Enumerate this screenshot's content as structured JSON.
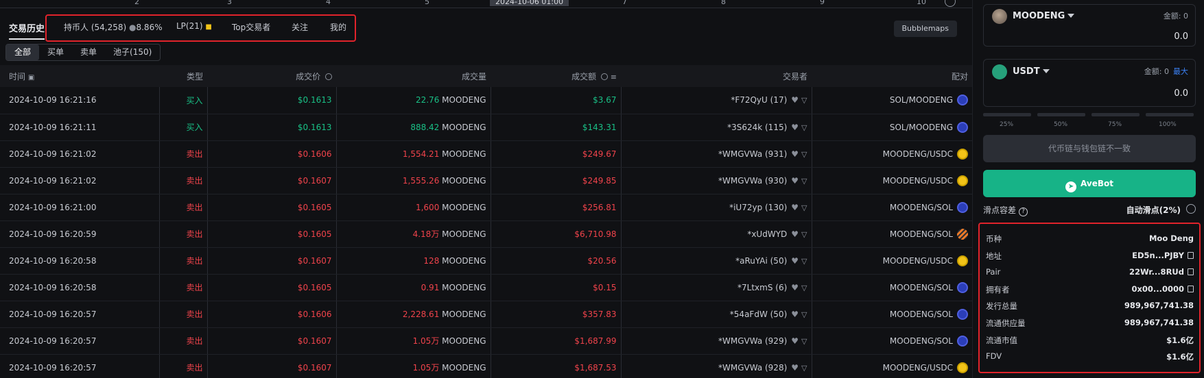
{
  "axis": {
    "ticks": [
      "2",
      "3",
      "4",
      "5",
      "7",
      "8",
      "9",
      "10"
    ],
    "crosshair_date": "2024-10-06   01:00"
  },
  "tabs": {
    "active": "交易历史",
    "holders_label": "持币人 (54,258)",
    "holders_pct": "8.86%",
    "lp": "LP(21)",
    "top_traders": "Top交易者",
    "follow": "关注",
    "mine": "我的"
  },
  "bubblemaps": "Bubblemaps",
  "filters": [
    "全部",
    "买单",
    "卖单",
    "池子(150)"
  ],
  "columns": {
    "time": "时间",
    "type": "类型",
    "price": "成交价",
    "volume": "成交量",
    "amount": "成交额",
    "trader": "交易者",
    "pair": "配对"
  },
  "rows": [
    {
      "time": "2024-10-09 16:21:16",
      "type": "买入",
      "side": "buy",
      "price": "$0.1613",
      "qty": "22.76",
      "unit": "MOODENG",
      "amount": "$3.67",
      "trader": "*F72QyU (17)",
      "pair": "SOL/MOODENG",
      "dex": "raydium"
    },
    {
      "time": "2024-10-09 16:21:11",
      "type": "买入",
      "side": "buy",
      "price": "$0.1613",
      "qty": "888.42",
      "unit": "MOODENG",
      "amount": "$143.31",
      "trader": "*3S624k (115)",
      "pair": "SOL/MOODENG",
      "dex": "raydium"
    },
    {
      "time": "2024-10-09 16:21:02",
      "type": "卖出",
      "side": "sell",
      "price": "$0.1606",
      "qty": "1,554.21",
      "unit": "MOODENG",
      "amount": "$249.67",
      "trader": "*WMGVWa (931)",
      "pair": "MOODENG/USDC",
      "dex": "orca"
    },
    {
      "time": "2024-10-09 16:21:02",
      "type": "卖出",
      "side": "sell",
      "price": "$0.1607",
      "qty": "1,555.26",
      "unit": "MOODENG",
      "amount": "$249.85",
      "trader": "*WMGVWa (930)",
      "pair": "MOODENG/USDC",
      "dex": "orca"
    },
    {
      "time": "2024-10-09 16:21:00",
      "type": "卖出",
      "side": "sell",
      "price": "$0.1605",
      "qty": "1,600",
      "unit": "MOODENG",
      "amount": "$256.81",
      "trader": "*iU72yp (130)",
      "pair": "MOODENG/SOL",
      "dex": "raydium"
    },
    {
      "time": "2024-10-09 16:20:59",
      "type": "卖出",
      "side": "sell",
      "price": "$0.1605",
      "qty": "4.18万",
      "unit": "MOODENG",
      "amount": "$6,710.98",
      "trader": "*xUdWYD",
      "pair": "MOODENG/SOL",
      "dex": "meteora"
    },
    {
      "time": "2024-10-09 16:20:58",
      "type": "卖出",
      "side": "sell",
      "price": "$0.1607",
      "qty": "128",
      "unit": "MOODENG",
      "amount": "$20.56",
      "trader": "*aRuYAi (50)",
      "pair": "MOODENG/USDC",
      "dex": "orca"
    },
    {
      "time": "2024-10-09 16:20:58",
      "type": "卖出",
      "side": "sell",
      "price": "$0.1605",
      "qty": "0.91",
      "unit": "MOODENG",
      "amount": "$0.15",
      "trader": "*7LtxmS (6)",
      "pair": "MOODENG/SOL",
      "dex": "raydium"
    },
    {
      "time": "2024-10-09 16:20:57",
      "type": "卖出",
      "side": "sell",
      "price": "$0.1606",
      "qty": "2,228.61",
      "unit": "MOODENG",
      "amount": "$357.83",
      "trader": "*54aFdW (50)",
      "pair": "MOODENG/SOL",
      "dex": "raydium"
    },
    {
      "time": "2024-10-09 16:20:57",
      "type": "卖出",
      "side": "sell",
      "price": "$0.1607",
      "qty": "1.05万",
      "unit": "MOODENG",
      "amount": "$1,687.99",
      "trader": "*WMGVWa (929)",
      "pair": "MOODENG/SOL",
      "dex": "raydium"
    },
    {
      "time": "2024-10-09 16:20:57",
      "type": "卖出",
      "side": "sell",
      "price": "$0.1607",
      "qty": "1.05万",
      "unit": "MOODENG",
      "amount": "$1,687.53",
      "trader": "*WMGVWa (928)",
      "pair": "MOODENG/USDC",
      "dex": "orca"
    }
  ],
  "swap": {
    "from_token": "MOODENG",
    "from_balance": "金额: 0",
    "from_amount": "0.0",
    "to_token": "USDT",
    "to_balance": "金额: 0",
    "max_label": "最大",
    "to_amount": "0.0",
    "pcts": [
      "25%",
      "50%",
      "75%",
      "100%"
    ],
    "disabled_msg": "代币链与钱包链不一致",
    "avebot": "AveBot",
    "slippage_label": "滑点容差",
    "slippage_value": "自动滑点(2%)"
  },
  "info": [
    {
      "k": "币种",
      "v": "Moo Deng",
      "copy": false
    },
    {
      "k": "地址",
      "v": "ED5n...PJBY",
      "copy": true
    },
    {
      "k": "Pair",
      "v": "22Wr...8RUd",
      "copy": true
    },
    {
      "k": "拥有者",
      "v": "0x00...0000",
      "copy": true
    },
    {
      "k": "发行总量",
      "v": "989,967,741.38",
      "copy": false
    },
    {
      "k": "流通供应量",
      "v": "989,967,741.38",
      "copy": false
    },
    {
      "k": "流通市值",
      "v": "$1.6亿",
      "copy": false
    },
    {
      "k": "FDV",
      "v": "$1.6亿",
      "copy": false
    }
  ],
  "colors": {
    "buy": "#19c086",
    "sell": "#f0434b",
    "accent": "#17b387",
    "highlight": "#e1232b"
  }
}
